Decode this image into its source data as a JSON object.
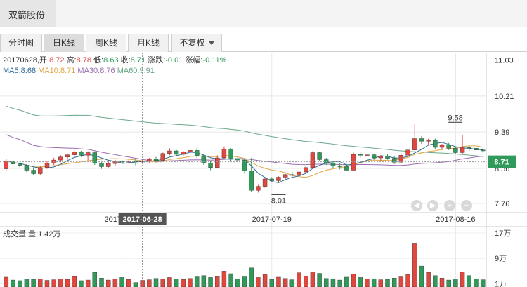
{
  "window": {
    "tab_title": "双箭股份"
  },
  "tabs": [
    {
      "label": "分时图"
    },
    {
      "label": "日K线"
    },
    {
      "label": "周K线"
    },
    {
      "label": "月K线"
    },
    {
      "label": "不复权"
    }
  ],
  "quote": {
    "date": "20170628",
    "open_label": "开:",
    "open": "8.72",
    "high_label": "高:",
    "high": "8.78",
    "low_label": "低:",
    "low": "8.63",
    "close_label": "收:",
    "close": "8.71",
    "change_label": "涨跌:",
    "change": "-0.01",
    "pct_label": "涨幅:",
    "pct": "-0.11%"
  },
  "ma": {
    "ma5": "MA5:8.68",
    "ma10": "MA10:8.71",
    "ma30": "MA30:8.76",
    "ma60": "MA60:9.91"
  },
  "volume_label": "成交量 量:1.42万",
  "colors": {
    "up": "#e0473d",
    "down": "#2f9a5a",
    "ma5": "#2e6b96",
    "ma10": "#e0a642",
    "ma30": "#9b6db0",
    "ma60": "#6ba88a",
    "price_tag": "#2f9a5a"
  },
  "controls": [
    "left-arrow-icon",
    "right-arrow-icon",
    "plus-icon",
    "minus-icon"
  ],
  "chart_data": {
    "type": "candlestick",
    "price_axis": {
      "ticks": [
        "11.03",
        "10.21",
        "9.39",
        "8.56",
        "7.76"
      ],
      "values": [
        11.03,
        10.21,
        9.39,
        8.56,
        7.76
      ],
      "ylim": [
        7.6,
        11.2
      ]
    },
    "volume_axis": {
      "ticks": [
        "17万",
        "9万",
        "1万"
      ],
      "values": [
        17,
        9,
        1
      ],
      "ylim": [
        0,
        17
      ]
    },
    "x_ticks": [
      "2017-06-2",
      "2017-07-19",
      "2017-08-16"
    ],
    "x_tick_index": [
      17,
      39,
      66
    ],
    "crosshair": {
      "index": 20,
      "date_label": "2017-06-28"
    },
    "current_price": "8.71",
    "annotations": [
      {
        "text": "9.58",
        "index": 67,
        "value": 9.58,
        "position": "above"
      },
      {
        "text": "8.01",
        "index": 40,
        "value": 8.01,
        "position": "below"
      }
    ],
    "candles": [
      [
        8.55,
        8.78,
        8.52,
        8.73,
        3.1
      ],
      [
        8.73,
        8.78,
        8.62,
        8.66,
        2.2
      ],
      [
        8.66,
        8.7,
        8.58,
        8.63,
        2.0
      ],
      [
        8.63,
        8.66,
        8.48,
        8.52,
        2.6
      ],
      [
        8.52,
        8.58,
        8.4,
        8.44,
        2.4
      ],
      [
        8.44,
        8.62,
        8.4,
        8.58,
        2.5
      ],
      [
        8.58,
        8.72,
        8.55,
        8.68,
        2.1
      ],
      [
        8.68,
        8.8,
        8.64,
        8.75,
        2.3
      ],
      [
        8.75,
        8.86,
        8.7,
        8.82,
        2.6
      ],
      [
        8.82,
        8.9,
        8.76,
        8.87,
        2.4
      ],
      [
        8.87,
        8.98,
        8.8,
        8.93,
        3.3
      ],
      [
        8.93,
        8.96,
        8.82,
        8.86,
        2.0
      ],
      [
        8.86,
        8.95,
        8.75,
        8.92,
        2.2
      ],
      [
        8.92,
        8.95,
        8.64,
        8.68,
        4.6
      ],
      [
        8.68,
        8.7,
        8.55,
        8.6,
        2.8
      ],
      [
        8.6,
        8.72,
        8.58,
        8.67,
        2.2
      ],
      [
        8.67,
        8.76,
        8.62,
        8.72,
        2.5
      ],
      [
        8.72,
        8.75,
        8.66,
        8.7,
        3.0
      ],
      [
        8.7,
        8.76,
        8.66,
        8.73,
        2.4
      ],
      [
        8.73,
        8.78,
        8.63,
        8.71,
        1.4
      ],
      [
        8.71,
        8.75,
        8.66,
        8.72,
        2.1
      ],
      [
        8.72,
        8.8,
        8.68,
        8.77,
        2.3
      ],
      [
        8.77,
        8.82,
        8.7,
        8.74,
        2.7
      ],
      [
        8.74,
        8.92,
        8.72,
        8.9,
        2.5
      ],
      [
        8.9,
        9.02,
        8.86,
        8.96,
        3.0
      ],
      [
        8.96,
        8.98,
        8.84,
        8.88,
        2.6
      ],
      [
        8.88,
        8.96,
        8.84,
        8.94,
        2.4
      ],
      [
        8.94,
        9.0,
        8.88,
        8.97,
        2.7
      ],
      [
        8.97,
        9.02,
        8.8,
        8.85,
        3.2
      ],
      [
        8.85,
        8.88,
        8.64,
        8.68,
        3.6
      ],
      [
        8.68,
        8.72,
        8.52,
        8.58,
        3.0
      ],
      [
        8.58,
        8.86,
        8.56,
        8.8,
        3.3
      ],
      [
        8.8,
        9.06,
        8.78,
        9.0,
        5.0
      ],
      [
        9.0,
        9.02,
        8.72,
        8.78,
        4.2
      ],
      [
        8.78,
        8.82,
        8.7,
        8.75,
        2.6
      ],
      [
        8.75,
        8.78,
        8.44,
        8.5,
        3.2
      ],
      [
        8.5,
        8.8,
        8.02,
        8.06,
        6.0
      ],
      [
        8.06,
        8.2,
        8.01,
        8.15,
        3.0
      ],
      [
        8.15,
        8.34,
        8.12,
        8.32,
        4.0
      ],
      [
        8.32,
        8.36,
        8.24,
        8.28,
        2.4
      ],
      [
        8.28,
        8.38,
        8.24,
        8.36,
        3.1
      ],
      [
        8.36,
        8.44,
        8.32,
        8.42,
        2.7
      ],
      [
        8.42,
        8.48,
        8.36,
        8.4,
        2.3
      ],
      [
        8.4,
        8.52,
        8.38,
        8.48,
        4.5
      ],
      [
        8.48,
        8.62,
        8.46,
        8.58,
        3.4
      ],
      [
        8.58,
        8.95,
        8.56,
        8.92,
        4.8
      ],
      [
        8.92,
        8.94,
        8.72,
        8.76,
        4.3
      ],
      [
        8.76,
        8.8,
        8.64,
        8.68,
        2.7
      ],
      [
        8.68,
        8.72,
        8.56,
        8.62,
        2.5
      ],
      [
        8.62,
        8.68,
        8.54,
        8.6,
        2.2
      ],
      [
        8.6,
        8.66,
        8.5,
        8.52,
        3.1
      ],
      [
        8.52,
        8.92,
        8.5,
        8.88,
        4.1
      ],
      [
        8.88,
        8.92,
        8.8,
        8.86,
        3.0
      ],
      [
        8.86,
        8.9,
        8.82,
        8.87,
        2.5
      ],
      [
        8.87,
        8.9,
        8.76,
        8.8,
        2.6
      ],
      [
        8.8,
        8.86,
        8.74,
        8.84,
        2.3
      ],
      [
        8.84,
        8.88,
        8.76,
        8.79,
        2.4
      ],
      [
        8.79,
        8.84,
        8.66,
        8.7,
        2.8
      ],
      [
        8.7,
        8.9,
        8.68,
        8.86,
        3.2
      ],
      [
        8.86,
        9.0,
        8.84,
        8.98,
        3.9
      ],
      [
        8.98,
        9.58,
        8.96,
        9.24,
        13.6
      ],
      [
        9.24,
        9.3,
        9.12,
        9.18,
        6.6
      ],
      [
        9.18,
        9.24,
        9.1,
        9.2,
        4.6
      ],
      [
        9.2,
        9.24,
        9.0,
        9.04,
        3.6
      ],
      [
        9.04,
        9.12,
        8.98,
        9.1,
        2.8
      ],
      [
        9.1,
        9.14,
        8.98,
        9.02,
        2.2
      ],
      [
        9.02,
        9.06,
        8.9,
        8.92,
        2.6
      ],
      [
        8.92,
        9.32,
        8.88,
        9.04,
        4.7
      ],
      [
        9.04,
        9.08,
        8.96,
        9.02,
        3.6
      ],
      [
        9.02,
        9.06,
        8.94,
        8.98,
        2.5
      ],
      [
        8.98,
        9.02,
        8.92,
        8.96,
        2.3
      ]
    ]
  }
}
